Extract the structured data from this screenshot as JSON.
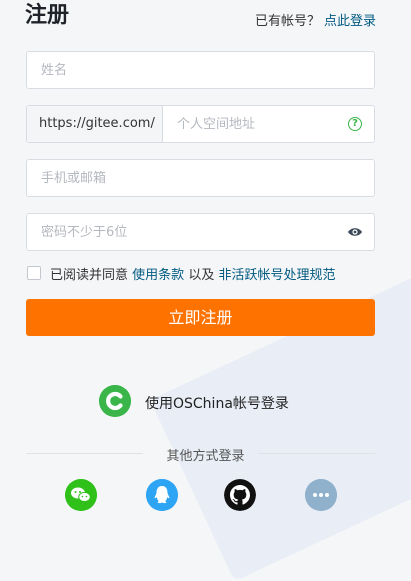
{
  "header": {
    "title": "注册",
    "login_question": "已有帐号？",
    "login_link": "点此登录"
  },
  "form": {
    "name_placeholder": "姓名",
    "url_prefix": "https://gitee.com/",
    "url_placeholder": "个人空间地址",
    "contact_placeholder": "手机或邮箱",
    "password_placeholder": "密码不少于6位",
    "agree_prefix": "已阅读并同意",
    "terms_link": "使用条款",
    "agree_and": "以及",
    "policy_link": "非活跃帐号处理规范",
    "submit_label": "立即注册"
  },
  "third_party": {
    "oschina_label": "使用OSChina帐号登录",
    "other_label": "其他方式登录",
    "icons": [
      "wechat-icon",
      "qq-icon",
      "github-icon",
      "more-icon"
    ]
  },
  "colors": {
    "accent": "#fe7300",
    "link": "#005980",
    "oschina_green": "#3ab54a"
  }
}
